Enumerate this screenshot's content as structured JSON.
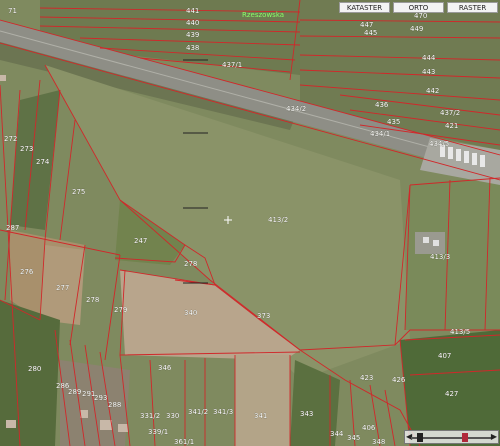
{
  "toolbar": {
    "kataster": "KATASTER",
    "orto": "ORTO",
    "raster": "RASTER"
  },
  "map": {
    "road_label": "Rzeszowska",
    "parcels": [
      "441",
      "440",
      "439",
      "438",
      "447",
      "445",
      "449",
      "470",
      "437/1",
      "444",
      "443",
      "442",
      "436",
      "437/2",
      "435",
      "434/1",
      "434/5",
      "434/2",
      "438",
      "272",
      "273",
      "274",
      "275",
      "276",
      "277",
      "278",
      "279",
      "280",
      "340",
      "373",
      "247",
      "278",
      "413/2",
      "413/3",
      "413/5",
      "426",
      "427",
      "423",
      "406",
      "407",
      "346",
      "331/2",
      "330",
      "341/2",
      "341/3",
      "341",
      "343",
      "344",
      "345",
      "348",
      "339/1",
      "286",
      "288",
      "289",
      "291",
      "293",
      "287",
      "361/1",
      "421",
      "71",
      "2"
    ]
  },
  "colors": {
    "parcel_border": "#d0282a",
    "field": "#808a5f",
    "highway": "#8c8c84"
  }
}
